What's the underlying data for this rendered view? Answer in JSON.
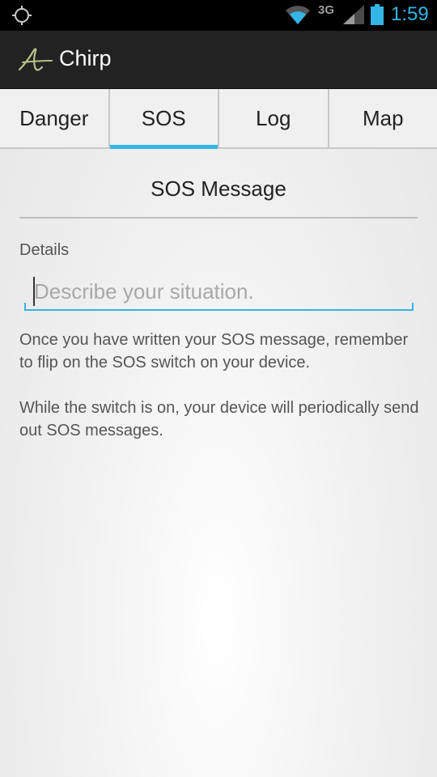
{
  "status_bar": {
    "network_type": "3G",
    "time": "1:59",
    "icons": [
      "gps-icon",
      "wifi-icon",
      "signal-icon",
      "battery-icon"
    ]
  },
  "action_bar": {
    "title": "Chirp",
    "logo_icon": "chirp-logo-icon"
  },
  "tabs": [
    {
      "label": "Danger",
      "active": false
    },
    {
      "label": "SOS",
      "active": true
    },
    {
      "label": "Log",
      "active": false
    },
    {
      "label": "Map",
      "active": false
    }
  ],
  "content": {
    "section_title": "SOS Message",
    "details_label": "Details",
    "details_input": {
      "value": "",
      "placeholder": "Describe your situation."
    },
    "info_paragraph_1": "Once you have written your SOS message, remember to flip on the SOS switch on your device.",
    "info_paragraph_2": "While the switch is on, your device will periodically send out SOS messages."
  },
  "colors": {
    "accent": "#33b5e5",
    "action_bar": "#222222",
    "status_bar": "#000000",
    "logo": "#b7c08a"
  }
}
